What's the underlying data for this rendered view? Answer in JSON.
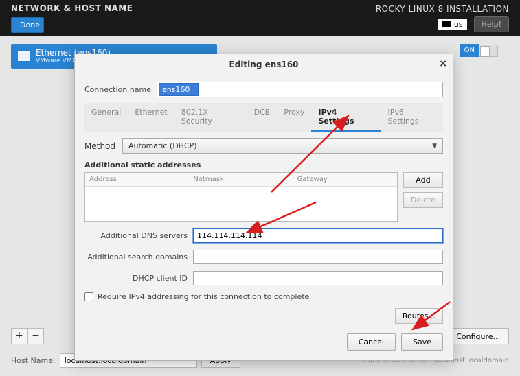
{
  "topbar": {
    "page_title": "NETWORK & HOST NAME",
    "done": "Done",
    "install_title": "ROCKY LINUX 8 INSTALLATION",
    "keyboard": "us",
    "help": "Help!"
  },
  "eth_card": {
    "title": "Ethernet (ens160)",
    "subtitle": "VMware VMXN",
    "toggle_label": "ON"
  },
  "bottom": {
    "plus": "+",
    "minus": "−",
    "configure": "Configure..."
  },
  "host": {
    "label": "Host Name:",
    "value": "localhost.localdomain",
    "apply": "Apply",
    "current_label": "Current host name:",
    "current_value": "localhost.localdomain"
  },
  "dialog": {
    "title": "Editing ens160",
    "conn_name_label": "Connection name",
    "conn_name_value": "ens160",
    "tabs": {
      "general": "General",
      "ethernet": "Ethernet",
      "sec": "802.1X Security",
      "dcb": "DCB",
      "proxy": "Proxy",
      "ipv4": "IPv4 Settings",
      "ipv6": "IPv6 Settings"
    },
    "method_label": "Method",
    "method_value": "Automatic (DHCP)",
    "addresses_label": "Additional static addresses",
    "cols": {
      "address": "Address",
      "netmask": "Netmask",
      "gateway": "Gateway"
    },
    "add": "Add",
    "delete": "Delete",
    "dns_label": "Additional DNS servers",
    "dns_value": "114.114.114.114",
    "search_label": "Additional search domains",
    "search_value": "",
    "dhcp_label": "DHCP client ID",
    "dhcp_value": "",
    "require_label": "Require IPv4 addressing for this connection to complete",
    "routes": "Routes...",
    "cancel": "Cancel",
    "save": "Save"
  }
}
